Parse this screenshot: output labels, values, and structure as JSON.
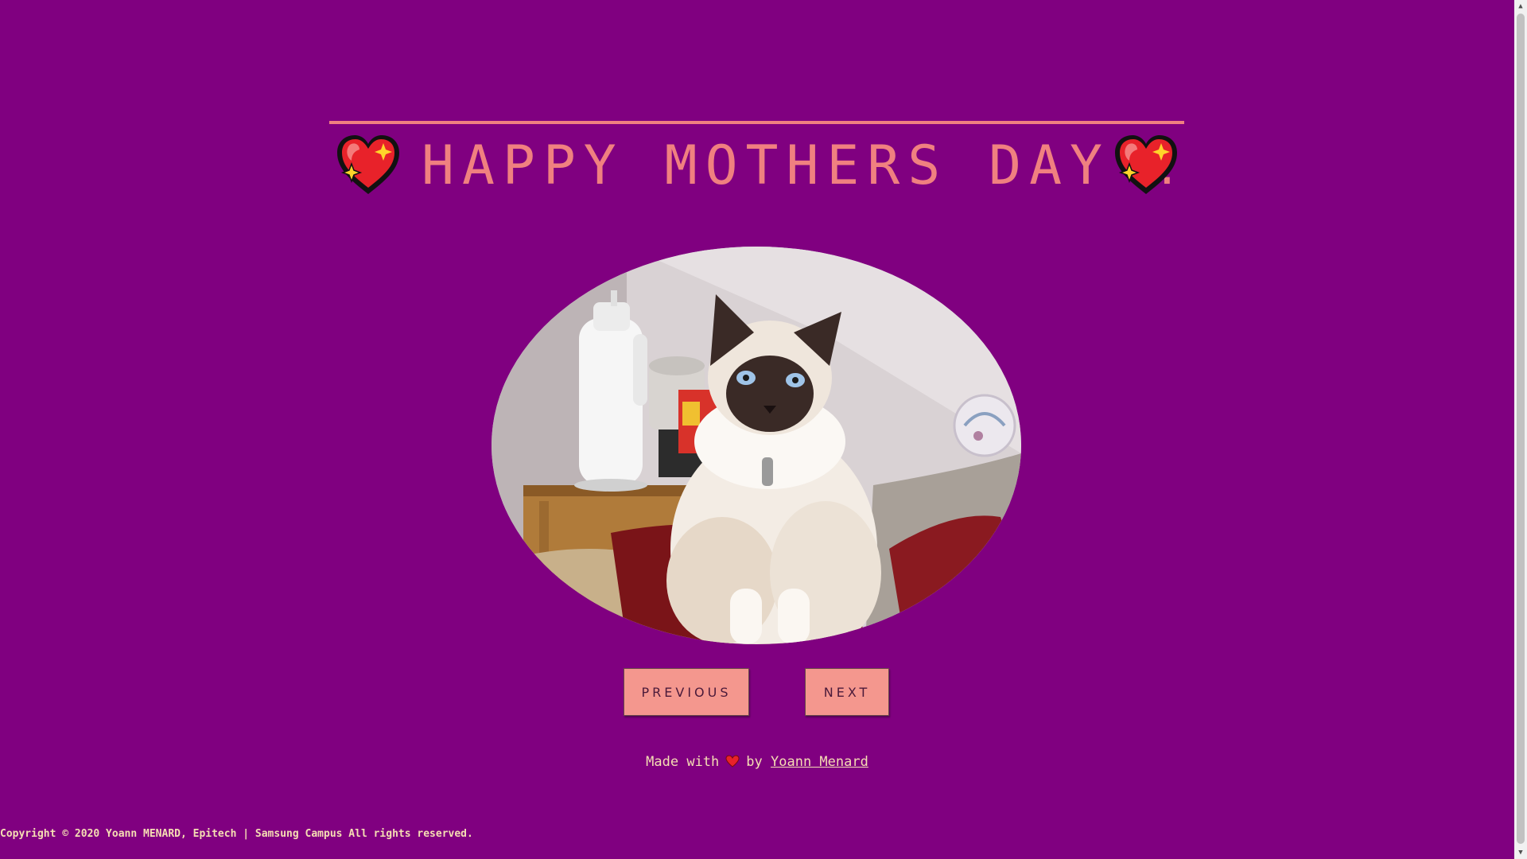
{
  "colors": {
    "background": "#800080",
    "accent": "#f08080",
    "button": "#f4978e",
    "footer_text": "#f5deb3"
  },
  "header": {
    "title": "HAPPY MOTHERS DAY !",
    "left_icon": "sparkling-heart-icon",
    "right_icon": "sparkling-heart-icon"
  },
  "gallery": {
    "image_alt": "Siamese-type cat sitting on a sofa next to a kitchen counter"
  },
  "controls": {
    "previous_label": "PREVIOUS",
    "next_label": "NEXT"
  },
  "credit": {
    "prefix": "Made with",
    "icon": "heart-icon",
    "by": "by",
    "author": "Yoann Menard"
  },
  "footer": {
    "copyright": "Copyright © 2020 Yoann MENARD, Epitech | Samsung Campus All rights reserved."
  }
}
